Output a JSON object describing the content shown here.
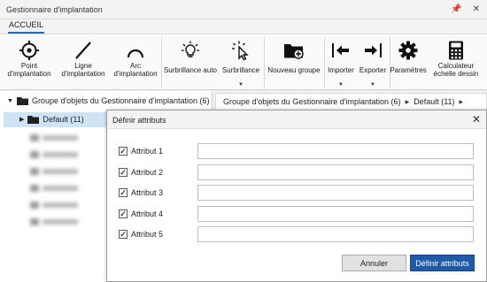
{
  "window": {
    "title": "Gestionnaire d'implantation"
  },
  "ribbon": {
    "tab": "ACCUEIL",
    "buttons": [
      {
        "label": "Point d'implantation",
        "icon": "target-icon"
      },
      {
        "label": "Ligne d'implantation",
        "icon": "line-icon"
      },
      {
        "label": "Arc d'implantation",
        "icon": "arc-icon"
      },
      {
        "label": "Surbrillance auto",
        "icon": "lightbulb-icon"
      },
      {
        "label": "Surbrillance",
        "icon": "highlight-cursor-icon"
      },
      {
        "label": "Nouveau groupe",
        "icon": "new-folder-icon"
      },
      {
        "label": "Importer",
        "icon": "import-icon"
      },
      {
        "label": "Exporter",
        "icon": "export-icon"
      },
      {
        "label": "Paramètres",
        "icon": "gear-icon"
      },
      {
        "label": "Calculateur échelle dessin",
        "icon": "calculator-icon"
      }
    ]
  },
  "tree": {
    "root_label": "Groupe d'objets du Gestionnaire d'implantation (6)",
    "default_label": "Default (11)"
  },
  "breadcrumb": {
    "items": [
      "Groupe d'objets du Gestionnaire d'implantation (6)",
      "Default (11)"
    ]
  },
  "dialog": {
    "title": "Définir attributs",
    "close_glyph": "✕",
    "attributes": [
      {
        "label": "Attribut 1",
        "checked": true,
        "value": ""
      },
      {
        "label": "Attribut 2",
        "checked": true,
        "value": ""
      },
      {
        "label": "Attribut 3",
        "checked": true,
        "value": ""
      },
      {
        "label": "Attribut 4",
        "checked": true,
        "value": ""
      },
      {
        "label": "Attribut 5",
        "checked": true,
        "value": ""
      }
    ],
    "cancel_label": "Annuler",
    "ok_label": "Définir attributs"
  },
  "colors": {
    "accent": "#1e5aa8",
    "selection": "#cfe3f7"
  }
}
